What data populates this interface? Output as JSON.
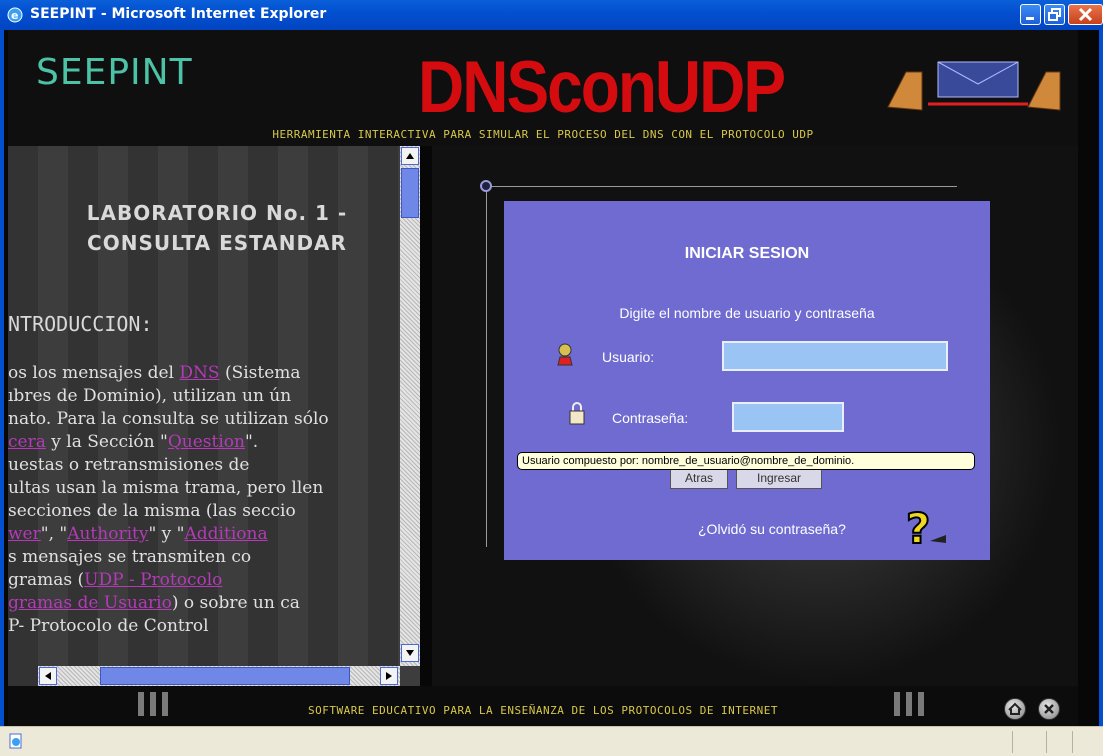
{
  "window": {
    "title": "SEEPINT - Microsoft Internet Explorer"
  },
  "header": {
    "logo": "SEEPINT",
    "app_name": "DNSconUDP",
    "subtitle": "HERRAMIENTA INTERACTIVA PARA SIMULAR EL PROCESO DEL DNS CON EL PROTOCOLO UDP"
  },
  "lesson": {
    "title": "LABORATORIO No. 1 - CONSULTA ESTANDAR",
    "section": "NTRODUCCION:",
    "lines": [
      {
        "pre": "os los mensajes del ",
        "link": "DNS",
        "post": " (Sistema"
      },
      {
        "pre": "ıbres de Dominio), utilizan un ún",
        "link": "",
        "post": ""
      },
      {
        "pre": "nato. Para la consulta se utilizan sólo",
        "link": "",
        "post": ""
      },
      {
        "pre": "",
        "link": "cera",
        "post": " y la Sección \"",
        "link2": "Question",
        "post2": "\"."
      },
      {
        "pre": "uestas o retransmisiones de",
        "link": "",
        "post": ""
      },
      {
        "pre": "ultas usan la misma trama, pero llen",
        "link": "",
        "post": ""
      },
      {
        "pre": "secciones de la misma (las seccio",
        "link": "",
        "post": ""
      },
      {
        "pre": "",
        "link": "wer",
        "post": "\", \"",
        "link2": "Authority",
        "post2": "\" y \"",
        "link3": "Additiona",
        "post3": ""
      },
      {
        "pre": "s mensajes se transmiten co",
        "link": "",
        "post": ""
      },
      {
        "pre": "gramas (",
        "link": "UDP - Protocolo",
        "post": ""
      },
      {
        "pre": "",
        "link": "gramas de Usuario",
        "post": ") o sobre un ca"
      },
      {
        "pre": "P- Protocolo de Control",
        "link": "",
        "post": ""
      }
    ]
  },
  "login": {
    "title": "INICIAR SESION",
    "instruction": "Digite el nombre de usuario y contraseña",
    "user_label": "Usuario:",
    "user_value": "",
    "password_label": "Contraseña:",
    "password_value": "",
    "back_button": "Atras",
    "submit_button": "Ingresar",
    "forgot_link": "¿Olvidó su contraseña?"
  },
  "tooltip": "Usuario compuesto por: nombre_de_usuario@nombre_de_dominio.",
  "footer": {
    "text": "SOFTWARE EDUCATIVO PARA LA ENSEÑANZA DE LOS PROTOCOLOS DE INTERNET"
  },
  "colors": {
    "title_bar": "#0350d0",
    "app_red": "#d40c10",
    "login_bg": "#6f6bd0",
    "subtitle_yellow": "#d8c84a"
  }
}
